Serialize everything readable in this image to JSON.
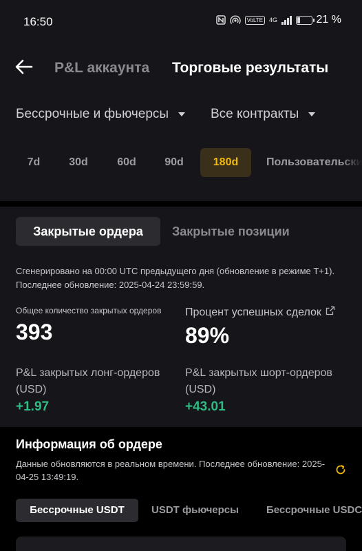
{
  "status_bar": {
    "time": "16:50",
    "battery_level": 0.21,
    "battery_text": "21 %",
    "network_small": "4G",
    "volte_label": "VoLTE"
  },
  "header": {
    "back_icon": "arrow-left-icon",
    "tab_pnl": "P&L аккаунта",
    "tab_trade": "Торговые результаты"
  },
  "filters": {
    "product": "Бессрочные и фьючерсы",
    "contracts": "Все контракты"
  },
  "periods": [
    "7d",
    "30d",
    "60d",
    "90d",
    "180d",
    "Пользовательский"
  ],
  "active_period": "180d",
  "segments": {
    "closed_orders": "Закрытые ордера",
    "closed_positions": "Закрытые позиции"
  },
  "generated_note": "Сгенерировано на 00:00 UTC предыдущего дня (обновление в режиме T+1). Последнее обновление: 2025-04-24 23:59:59.",
  "stats": {
    "total_orders_label": "Общее количество закрытых ордеров",
    "total_orders_value": "393",
    "win_rate_label": "Процент успешных сделок",
    "win_rate_value": "89%",
    "long_pl_label": "P&L закрытых лонг-ордеров (USD)",
    "long_pl_value": "+1.97",
    "short_pl_label": "P&L закрытых шорт-ордеров (USD)",
    "short_pl_value": "+43.01"
  },
  "order_info": {
    "title": "Информация об ордере",
    "note": "Данные обновляются в реальном времени. Последнее обновление: 2025-04-25 13:49:19.",
    "tabs": [
      "Бессрочные USDT",
      "USDT фьючерсы",
      "Бессрочные USDC"
    ]
  },
  "colors": {
    "accent": "#f0b90b",
    "profit": "#2ebd85",
    "background": "#16161a"
  }
}
